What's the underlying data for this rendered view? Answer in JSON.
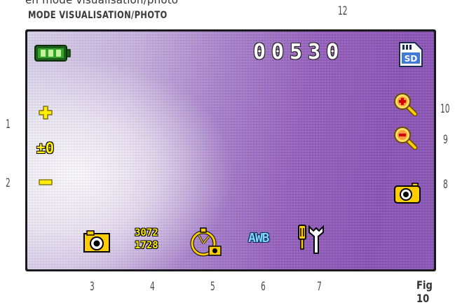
{
  "page": {
    "cut_title": "en mode visualisation/photo",
    "section_title": "MODE VISUALISATION/PHOTO",
    "figure_label": "Fig 10"
  },
  "callouts": [
    "1",
    "2",
    "3",
    "4",
    "5",
    "6",
    "7",
    "8",
    "9",
    "10",
    "12"
  ],
  "osd": {
    "counter": "00530",
    "ev_value": "±0",
    "resolution_w": "3072",
    "resolution_h": "1728",
    "white_balance": "AWB",
    "storage": "SD",
    "battery_level": 1.0
  },
  "icons": {
    "battery": "battery-full-icon",
    "sd": "sd-card-icon",
    "plus": "plus-icon",
    "minus": "minus-icon",
    "zoom_in": "zoom-in-icon",
    "zoom_out": "zoom-out-icon",
    "camera_right": "camera-icon",
    "camera_bottom": "camera-mode-icon",
    "timer": "self-timer-icon",
    "tools": "settings-tools-icon"
  },
  "colors": {
    "osd_yellow": "#ffee00",
    "osd_blue": "#7fd7ff",
    "battery_green": "#2fa52a",
    "screen_purple": "#8b53b6",
    "bezel": "#1a1a1e"
  }
}
